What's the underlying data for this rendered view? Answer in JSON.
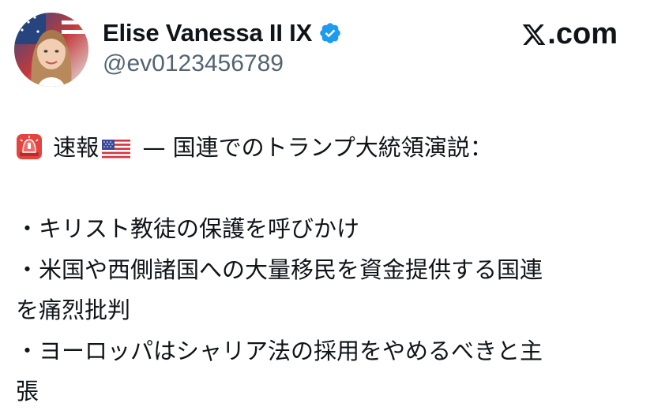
{
  "author": {
    "name": "Elise Vanessa II IX",
    "handle": "@ev0123456789",
    "verified": true,
    "verified_color": "#1d9bf0"
  },
  "brand": {
    "label": ".com",
    "icon": "x-logo-icon"
  },
  "tweet": {
    "headline_emoji": "police-light-icon",
    "headline_flag": "us-flag-icon",
    "headline_part1": "速報",
    "headline_part2": " — 国連でのトランプ大統領演説：",
    "bullets": [
      "・キリスト教徒の保護を呼びかけ",
      "・米国や西側諸国への大量移民を資金提供する国連",
      "を痛烈批判",
      "・ヨーロッパはシャリア法の採用をやめるべきと主",
      "張"
    ]
  },
  "colors": {
    "text": "#0f1419",
    "secondary": "#536471",
    "accent": "#1d9bf0"
  }
}
